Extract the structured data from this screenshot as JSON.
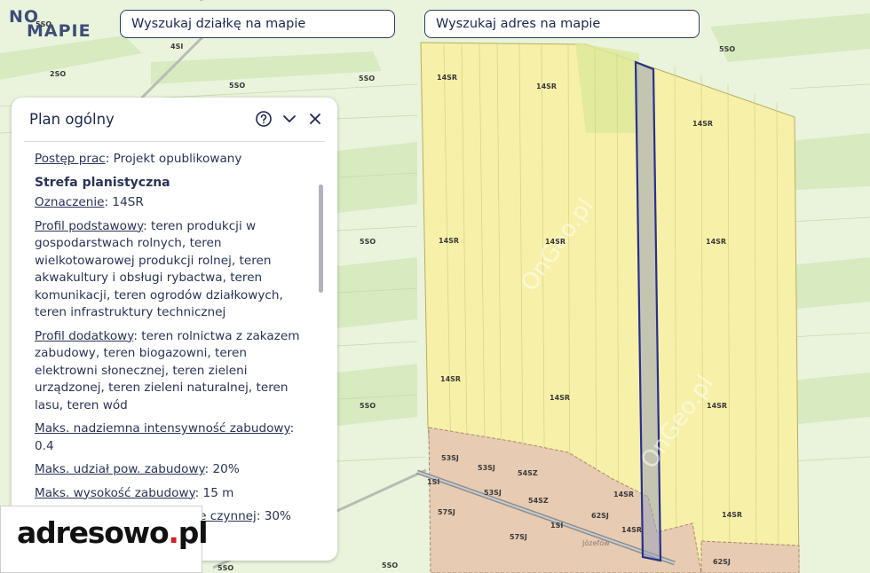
{
  "logo": {
    "line1": "NO",
    "line2": "MAPIE"
  },
  "search": {
    "parcel_placeholder": "Wyszukaj działkę na mapie",
    "address_placeholder": "Wyszukaj adres na mapie"
  },
  "panel": {
    "title": "Plan ogólny",
    "rows": [
      {
        "label": "Postęp prac",
        "value": ": Projekt opublikowany"
      },
      {
        "heading": "Strefa planistyczna"
      },
      {
        "label": "Oznaczenie",
        "value": ": 14SR"
      },
      {
        "label": "Profil podstawowy",
        "value": ": teren produkcji w gospodarstwach rolnych, teren wielkotowarowej produkcji rolnej, teren akwakultury i obsługi rybactwa, teren komunikacji, teren ogrodów działkowych, teren infrastruktury technicznej"
      },
      {
        "label": "Profil dodatkowy",
        "value": ": teren rolnictwa z zakazem zabudowy, teren biogazowni, teren elektrowni słonecznej, teren zieleni urządzonej, teren zieleni naturalnej, teren lasu, teren wód"
      },
      {
        "label": "Maks. nadziemna intensywność zabudowy",
        "value": ": 0.4"
      },
      {
        "label": "Maks. udział pow. zabudowy",
        "value": ": 20%"
      },
      {
        "label": "Maks. wysokość zabudowy",
        "value": ": 15 m"
      },
      {
        "label": "Min. udział pow. biologicznie czynnej",
        "value": ": 30%"
      }
    ]
  },
  "map": {
    "zone_labels": [
      "14SR",
      "14SR",
      "14SR",
      "14SR",
      "14SR",
      "14SR",
      "14SR",
      "14SR",
      "14SR",
      "14SR",
      "14SR",
      "14SR",
      "5SO",
      "5SO",
      "5SO",
      "5SO",
      "5SO",
      "5SO",
      "5SO",
      "5SO",
      "2SO",
      "4SI",
      "1SI",
      "1SI",
      "53SJ",
      "53SJ",
      "53SJ",
      "54SZ",
      "54SZ",
      "57SJ",
      "57SJ",
      "62SJ",
      "62SJ"
    ],
    "place_label": "Józefów",
    "watermark": "OnGeo.pl",
    "colors": {
      "farmland": "#f7f0a8",
      "forest": "#dcebc4",
      "residential": "#e7cbb2",
      "selection": "#27318c"
    }
  },
  "ad": {
    "brand": "adresowo",
    "dot": ".",
    "tld": "pl"
  }
}
